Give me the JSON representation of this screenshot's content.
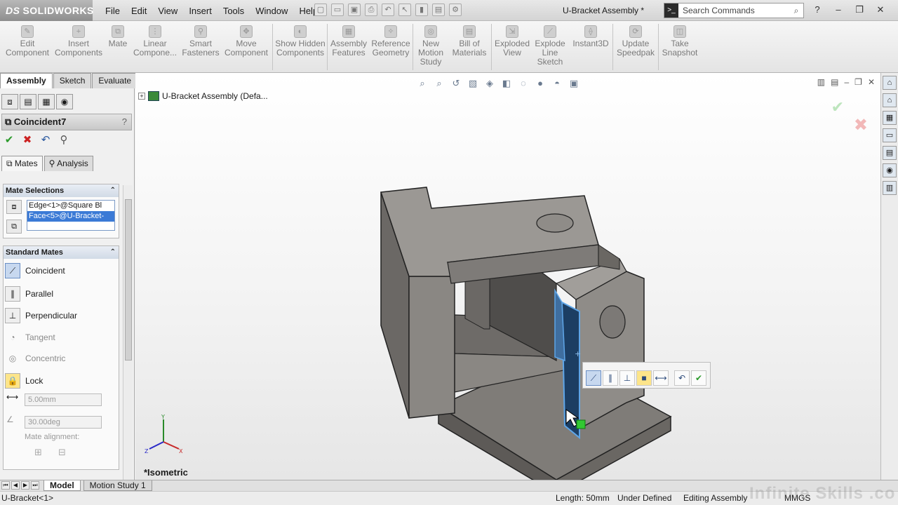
{
  "app": {
    "logo": "SOLIDWORKS",
    "doc_title": "U-Bracket Assembly *"
  },
  "menu": [
    "File",
    "Edit",
    "View",
    "Insert",
    "Tools",
    "Window",
    "Help"
  ],
  "search": {
    "placeholder": "Search Commands"
  },
  "toolbar": {
    "edit_component": "Edit Component",
    "insert_components": "Insert Components",
    "mate": "Mate",
    "linear_component": "Linear Compone...",
    "smart_fasteners": "Smart Fasteners",
    "move_component": "Move Component",
    "show_hidden": "Show Hidden Components",
    "assembly_features": "Assembly Features",
    "reference_geometry": "Reference Geometry",
    "new_motion_study": "New Motion Study",
    "bill_of_materials": "Bill of Materials",
    "exploded_view": "Exploded View",
    "explode_line_sketch": "Explode Line Sketch",
    "instant3d": "Instant3D",
    "update_speedpak": "Update Speedpak",
    "take_snapshot": "Take Snapshot"
  },
  "tabs": [
    "Assembly",
    "Sketch",
    "Evaluate"
  ],
  "property": {
    "title": "Coincident7",
    "help": "?",
    "subtabs": [
      "Mates",
      "Analysis"
    ],
    "mate_selections_header": "Mate Selections",
    "selections": [
      "Edge<1>@Square Bl",
      "Face<5>@U-Bracket-"
    ],
    "standard_mates_header": "Standard Mates",
    "mates": {
      "coincident": "Coincident",
      "parallel": "Parallel",
      "perpendicular": "Perpendicular",
      "tangent": "Tangent",
      "concentric": "Concentric",
      "lock": "Lock"
    },
    "distance_value": "5.00mm",
    "angle_value": "30.00deg",
    "mate_alignment": "Mate alignment:"
  },
  "viewport": {
    "tree_root": "U-Bracket Assembly  (Defa...",
    "view_name": "*Isometric"
  },
  "bottom_tabs": [
    "Model",
    "Motion Study 1"
  ],
  "status": {
    "selection": "U-Bracket<1>",
    "length": "Length: 50mm",
    "definition": "Under Defined",
    "mode": "Editing Assembly",
    "units": "MMGS"
  },
  "watermark": "Infinite Skills .co",
  "colors": {
    "selection": "#3b7ad6",
    "highlight_face": "#1c3e63",
    "part_gray": "#8f8c88"
  }
}
